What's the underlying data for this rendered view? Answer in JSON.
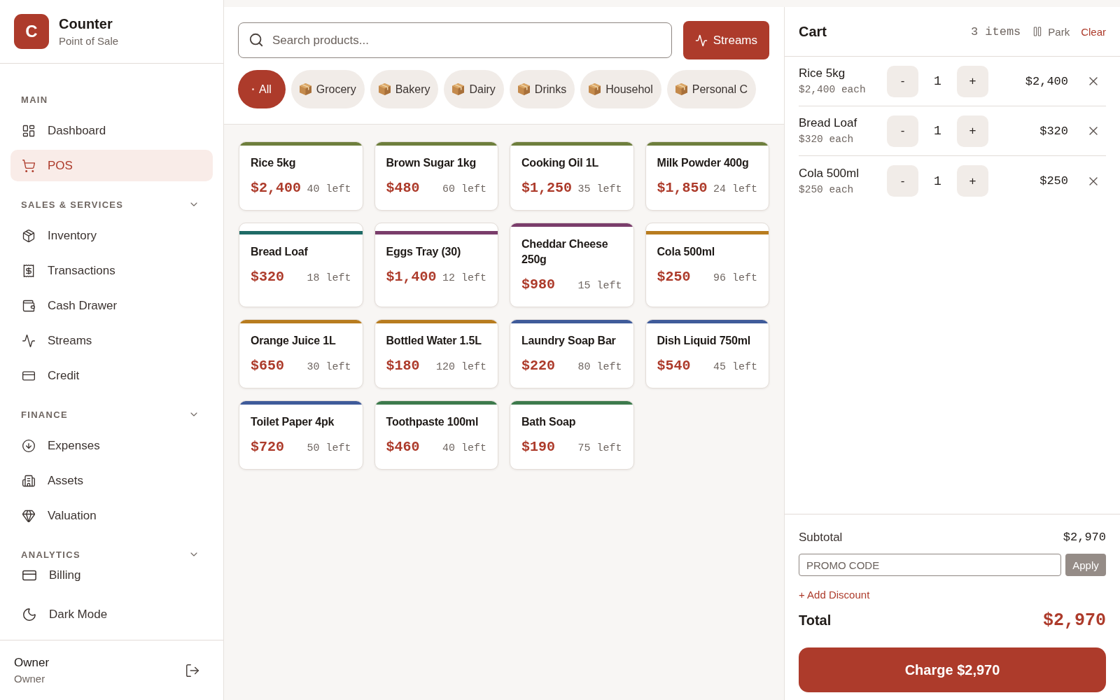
{
  "sidebar": {
    "logo": "C",
    "brand": "Counter",
    "tagline": "Point of Sale",
    "sections": [
      {
        "heading": "MAIN",
        "collapsible": false,
        "expanded": true,
        "items": [
          {
            "label": "Dashboard",
            "selected": false
          },
          {
            "label": "POS",
            "selected": true
          }
        ]
      },
      {
        "heading": "SALES & SERVICES",
        "collapsible": true,
        "expanded": true,
        "items": [
          {
            "label": "Inventory",
            "selected": false
          },
          {
            "label": "Transactions",
            "selected": false
          },
          {
            "label": "Cash Drawer",
            "selected": false
          },
          {
            "label": "Streams",
            "selected": false
          },
          {
            "label": "Credit",
            "selected": false
          }
        ]
      },
      {
        "heading": "FINANCE",
        "collapsible": true,
        "expanded": true,
        "items": [
          {
            "label": "Expenses",
            "selected": false
          },
          {
            "label": "Assets",
            "selected": false
          },
          {
            "label": "Valuation",
            "selected": false
          }
        ]
      },
      {
        "heading": "ANALYTICS",
        "collapsible": true,
        "expanded": true
      }
    ],
    "bottom_items": [
      {
        "label": "Billing",
        "selected": false
      },
      {
        "label": "Dark Mode",
        "selected": false
      }
    ],
    "user": {
      "name": "Owner",
      "role": "Owner"
    }
  },
  "toolbar": {
    "search": {
      "placeholder": "Search products..."
    },
    "streams_button": "Streams"
  },
  "categories": [
    {
      "label": "All",
      "kind": "all",
      "selected": true
    },
    {
      "label": "Grocery",
      "kind": "category",
      "selected": false
    },
    {
      "label": "Bakery",
      "kind": "category",
      "selected": false
    },
    {
      "label": "Dairy",
      "kind": "category",
      "selected": false
    },
    {
      "label": "Drinks",
      "kind": "category",
      "selected": false
    },
    {
      "label": "Househol",
      "kind": "category",
      "selected": false
    },
    {
      "label": "Personal C",
      "kind": "category",
      "selected": false
    }
  ],
  "products": [
    {
      "name": "Rice 5kg",
      "price": "$2,400",
      "stock": "40 left",
      "color": "#6e7f3d"
    },
    {
      "name": "Brown Sugar 1kg",
      "price": "$480",
      "stock": "60 left",
      "color": "#6e7f3d"
    },
    {
      "name": "Cooking Oil 1L",
      "price": "$1,250",
      "stock": "35 left",
      "color": "#6e7f3d"
    },
    {
      "name": "Milk Powder 400g",
      "price": "$1,850",
      "stock": "24 left",
      "color": "#6e7f3d"
    },
    {
      "name": "Bread Loaf",
      "price": "$320",
      "stock": "18 left",
      "color": "#1f6b66"
    },
    {
      "name": "Eggs Tray (30)",
      "price": "$1,400",
      "stock": "12 left",
      "color": "#7a3d6b"
    },
    {
      "name": "Cheddar Cheese 250g",
      "price": "$980",
      "stock": "15 left",
      "color": "#7a3d6b"
    },
    {
      "name": "Cola 500ml",
      "price": "$250",
      "stock": "96 left",
      "color": "#b87c1f"
    },
    {
      "name": "Orange Juice 1L",
      "price": "$650",
      "stock": "30 left",
      "color": "#b87c1f"
    },
    {
      "name": "Bottled Water 1.5L",
      "price": "$180",
      "stock": "120 left",
      "color": "#b87c1f"
    },
    {
      "name": "Laundry Soap Bar",
      "price": "$220",
      "stock": "80 left",
      "color": "#3f5b9a"
    },
    {
      "name": "Dish Liquid 750ml",
      "price": "$540",
      "stock": "45 left",
      "color": "#3f5b9a"
    },
    {
      "name": "Toilet Paper 4pk",
      "price": "$720",
      "stock": "50 left",
      "color": "#3f5b9a"
    },
    {
      "name": "Toothpaste 100ml",
      "price": "$460",
      "stock": "40 left",
      "color": "#3d7a4c"
    },
    {
      "name": "Bath Soap",
      "price": "$190",
      "stock": "75 left",
      "color": "#3d7a4c"
    }
  ],
  "cart": {
    "title": "Cart",
    "count": "3 items",
    "park": "Park",
    "clear": "Clear",
    "items": [
      {
        "name": "Rice 5kg",
        "unit_price": "$2,400 each",
        "decrease": "-",
        "quantity": "1",
        "increase": "+",
        "total": "$2,400"
      },
      {
        "name": "Bread Loaf",
        "unit_price": "$320 each",
        "decrease": "-",
        "quantity": "1",
        "increase": "+",
        "total": "$320"
      },
      {
        "name": "Cola 500ml",
        "unit_price": "$250 each",
        "decrease": "-",
        "quantity": "1",
        "increase": "+",
        "total": "$250"
      }
    ],
    "subtotal_label": "Subtotal",
    "subtotal": "$2,970",
    "promo": {
      "placeholder": "PROMO CODE"
    },
    "apply": {
      "label": "Apply",
      "disabled": true
    },
    "add_discount": "+ Add Discount",
    "total_label": "Total",
    "total": "$2,970",
    "charge_button": "Charge $2,970"
  }
}
